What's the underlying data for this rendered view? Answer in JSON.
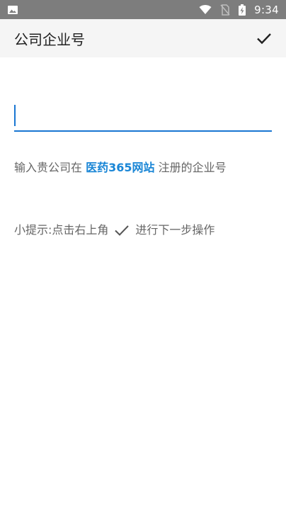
{
  "status_bar": {
    "time": "9:34",
    "icons": [
      "image-icon",
      "wifi-icon",
      "no-sim-icon",
      "battery-charging-icon"
    ],
    "background": "#7d7d7d"
  },
  "toolbar": {
    "title": "公司企业号",
    "confirm_icon": "check-icon",
    "background": "#f5f5f5"
  },
  "form": {
    "enterprise_number_value": "",
    "accent_color": "#1976d2"
  },
  "hint": {
    "prefix": "输入贵公司在",
    "link": "医药365网站",
    "suffix": "注册的企业号",
    "link_color": "#1a86d6"
  },
  "tip": {
    "prefix": "小提示:点击右上角",
    "icon": "check-icon",
    "suffix": "进行下一步操作"
  }
}
